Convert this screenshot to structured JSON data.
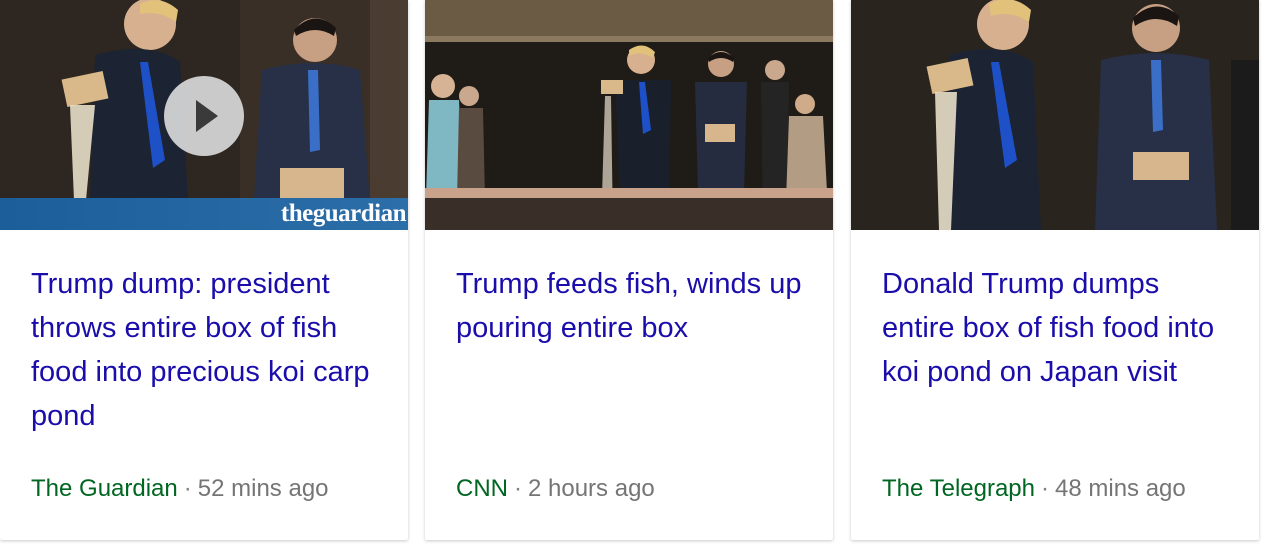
{
  "cards": [
    {
      "title": "Trump dump: president throws entire box of fish food into precious koi carp pond",
      "source": "The Guardian",
      "separator": "·",
      "time": "52 mins ago",
      "watermark": "theguardian",
      "has_video": true,
      "image_icon": "photo-icon"
    },
    {
      "title": "Trump feeds fish, winds up pouring entire box",
      "source": "CNN",
      "separator": "·",
      "time": "2 hours ago",
      "has_video": false,
      "image_icon": "photo-icon"
    },
    {
      "title": "Donald Trump dumps entire box of fish food into koi pond on Japan visit",
      "source": "The Telegraph",
      "separator": "·",
      "time": "48 mins ago",
      "has_video": false,
      "image_icon": "photo-icon"
    }
  ],
  "colors": {
    "headline": "#1a0dab",
    "source": "#006621",
    "time": "#757575"
  }
}
